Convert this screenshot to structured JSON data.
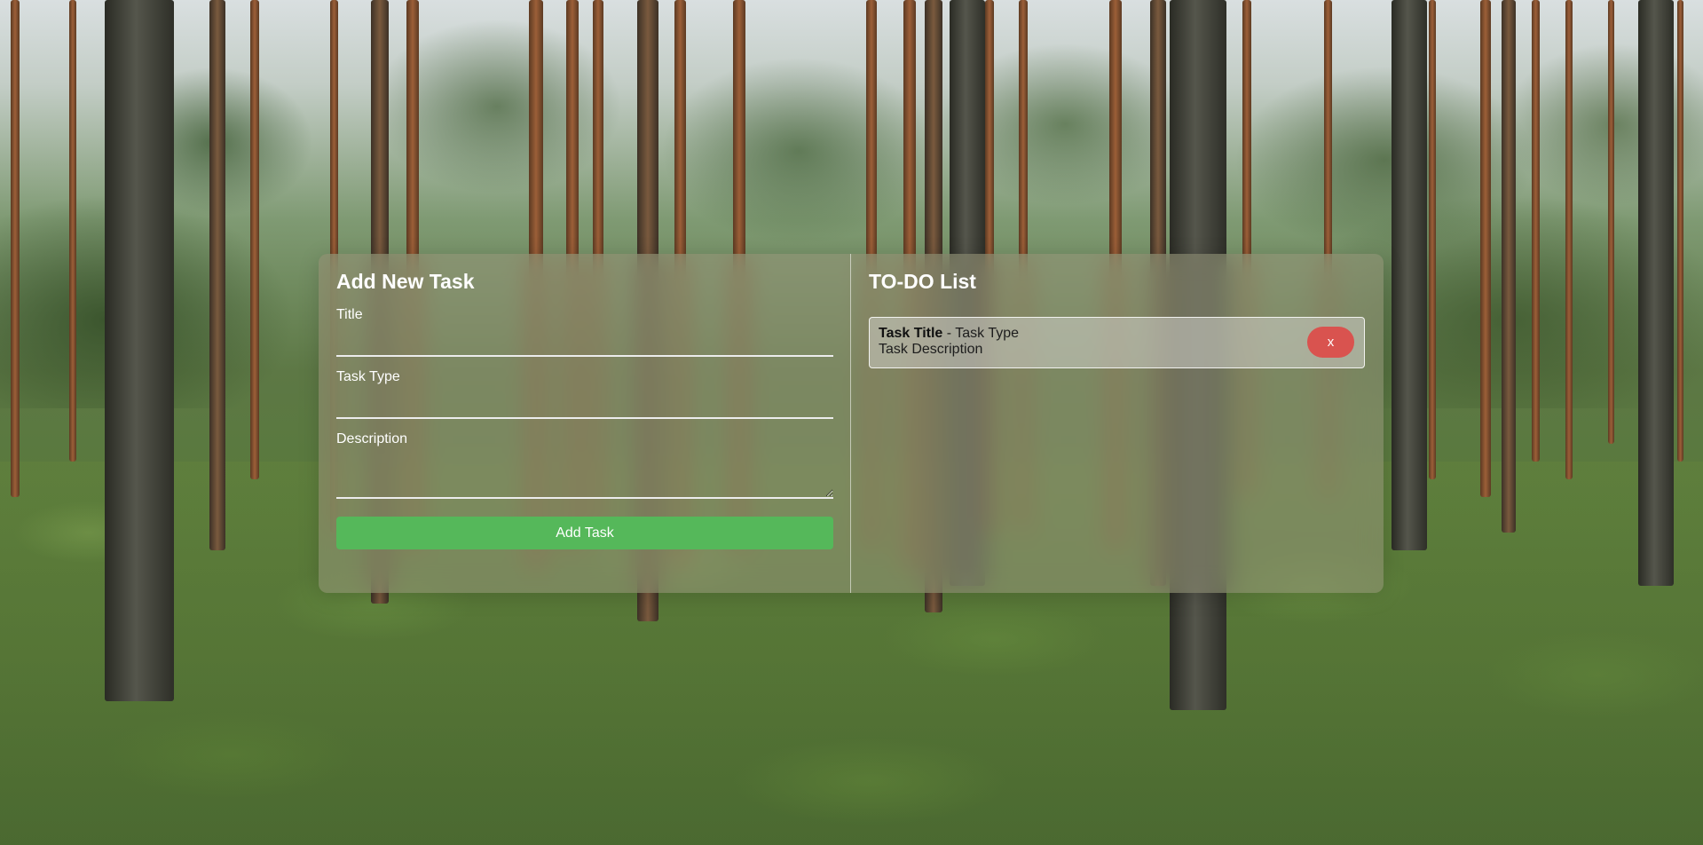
{
  "add_task": {
    "heading": "Add New Task",
    "title_label": "Title",
    "title_value": "",
    "type_label": "Task Type",
    "type_value": "",
    "description_label": "Description",
    "description_value": "",
    "submit_label": "Add Task"
  },
  "todo": {
    "heading": "TO-DO List",
    "items": [
      {
        "title": "Task Title",
        "separator": " - ",
        "type": "Task Type",
        "description": "Task Description",
        "delete_label": "x"
      }
    ]
  },
  "colors": {
    "add_button": "#55b85a",
    "delete_button": "#d9534f",
    "heading_text": "#ffffff"
  },
  "icons": {
    "textarea_resize": "resize-grip-icon"
  }
}
